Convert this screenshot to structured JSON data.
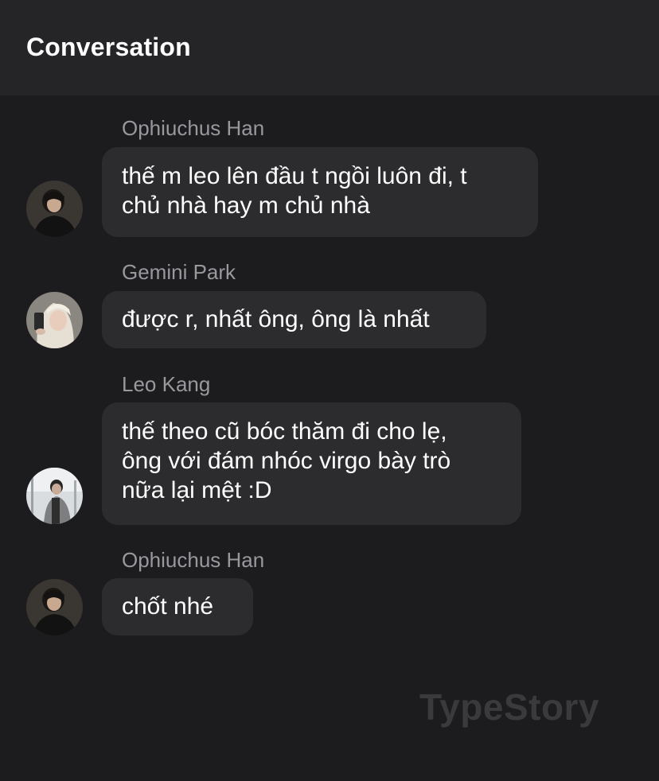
{
  "header": {
    "title": "Conversation"
  },
  "messages": [
    {
      "sender": "Ophiuchus Han",
      "lines": [
        "thế m leo lên đầu t ngồi luôn đi, t",
        "chủ nhà hay m chủ nhà"
      ],
      "avatar": "avatar-dark-hair-black-shirt"
    },
    {
      "sender": "Gemini Park",
      "lines": [
        "được r, nhất ông, ông là nhất"
      ],
      "avatar": "avatar-blonde-hair-phone-selfie"
    },
    {
      "sender": "Leo Kang",
      "lines": [
        "thế theo cũ bóc thăm đi cho lẹ,",
        "ông với đám nhóc virgo bày trò",
        "nữa lại mệt :D"
      ],
      "avatar": "avatar-grey-jacket-outdoor"
    },
    {
      "sender": "Ophiuchus Han",
      "lines": [
        "chốt nhé"
      ],
      "avatar": "avatar-dark-hair-black-shirt"
    }
  ],
  "watermark": "TypeStory",
  "colors": {
    "background": "#1c1c1e",
    "header": "#252527",
    "bubble": "#2c2c2e",
    "sender_name": "#98989d",
    "message_text": "#ffffff",
    "watermark": "#3a3a3c"
  }
}
